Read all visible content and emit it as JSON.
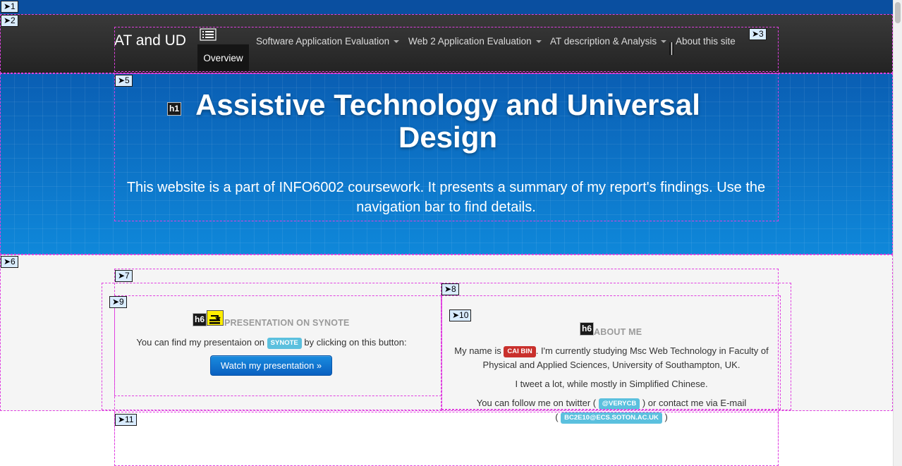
{
  "navbar": {
    "brand": "AT and UD",
    "items": [
      {
        "label": "Software Application Evaluation"
      },
      {
        "label": "Web 2 Application Evaluation"
      },
      {
        "label": "AT description & Analysis"
      },
      {
        "label": "About this site"
      }
    ],
    "active_item": "Overview"
  },
  "hero": {
    "title": "Assistive Technology and Universal Design",
    "subtitle": "This website is a part of INFO6002 coursework. It presents a summary of my report's findings. Use the navigation bar to find details."
  },
  "presentation": {
    "title": "PRESENTATION ON SYNOTE",
    "text_before": "You can find my presentaion on",
    "tag": "SYNOTE",
    "text_after": "by clicking on this button:",
    "button": "Watch my presentation »"
  },
  "about": {
    "title": "ABOUT ME",
    "line1_before": "My name is",
    "name_tag": "CAI BIN",
    "line1_after": ". I'm currently studying Msc Web Technology in Faculty of",
    "line2": "Physical and Applied Sciences, University of Southampton, UK.",
    "line3": "I tweet a lot, while mostly in Simplified Chinese.",
    "line4_before": "You can follow me on twitter (",
    "twitter_tag": "@VERYCB",
    "line4_after": ") or contact me via E-mail",
    "email_open": "(",
    "email_tag": "BC2E10@ECS.SOTON.AC.UK",
    "email_close": ")"
  },
  "markers": {
    "b1": "➤1",
    "b2": "➤2",
    "b3": "➤3",
    "b5": "➤5",
    "b6": "➤6",
    "b7": "➤7",
    "b8": "➤8",
    "b9": "➤9",
    "b10": "➤10",
    "b11": "➤11",
    "h1": "h1",
    "h6a": "h6",
    "h6b": "h6"
  },
  "colors": {
    "navbar": "#2d2d2d",
    "hero": "#0b72c9",
    "primary_button": "#0a60c0",
    "label_info": "#5bc0de",
    "label_important": "#c9302c",
    "marker_outline": "#e040e0"
  }
}
